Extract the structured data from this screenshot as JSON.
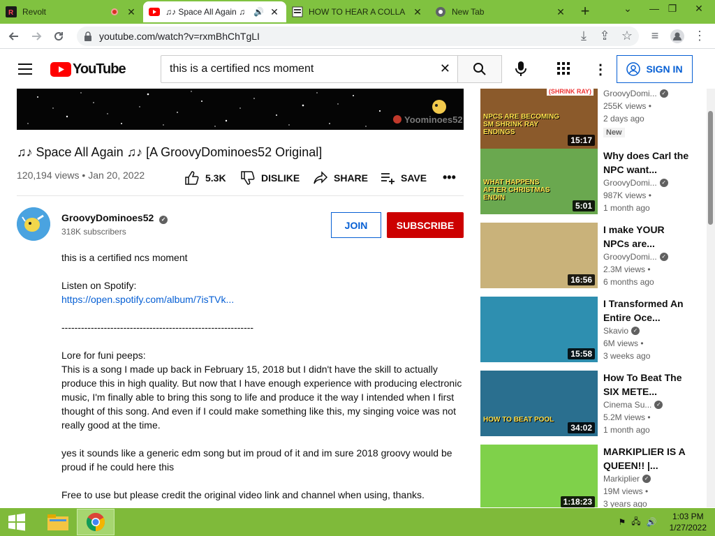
{
  "browser": {
    "tabs": [
      {
        "title": "Revolt",
        "icon": "revolt-icon",
        "recording": true
      },
      {
        "title": "♫♪ Space All Again ♫",
        "icon": "youtube-icon",
        "audio": true,
        "active": true
      },
      {
        "title": "HOW TO HEAR A COLLA",
        "icon": "page-icon"
      },
      {
        "title": "New Tab",
        "icon": "chrome-icon"
      }
    ],
    "url": "youtube.com/watch?v=rxmBhChTgLI"
  },
  "youtube": {
    "logo_text": "YouTube",
    "search_value": "this is a certified ncs moment",
    "signin_label": "SIGN IN"
  },
  "video": {
    "watermark": "Yoominoes52",
    "title": "♫♪ Space All Again ♫♪ [A GroovyDominoes52 Original]",
    "views": "120,194 views",
    "date": "Jan 20, 2022",
    "likes": "5.3K",
    "dislike_label": "DISLIKE",
    "share_label": "SHARE",
    "save_label": "SAVE"
  },
  "channel": {
    "name": "GroovyDominoes52",
    "subscribers": "318K subscribers",
    "join_label": "JOIN",
    "subscribe_label": "SUBSCRIBE"
  },
  "description": {
    "line1": "this is a certified ncs moment",
    "spotify_label": "Listen on Spotify:",
    "spotify_link": "https://open.spotify.com/album/7isTVk...",
    "separator": "-----------------------------------------------------------",
    "lore_title": "Lore for funi peeps:",
    "lore_body": "This is a song I made up back in February 15, 2018 but I didn't have the skill to actually produce this in high quality. But now that I have enough experience with producing electronic music, I'm finally able to bring this song to life and produce it the way I intended when I first thought of this song. And even if I could make something like this, my singing voice was not really good at the time.",
    "para2": "yes it sounds like a generic edm song but im proud of it and im sure 2018 groovy would be proud if he could here this",
    "para3": "Free to use but please credit the original video link and channel when using, thanks."
  },
  "recommendations": [
    {
      "title": "",
      "channel": "GroovyDomi...",
      "views": "255K views",
      "age": "2 days ago",
      "badge": "New",
      "duration": "15:17",
      "thumb_text": "NPCS ARE BECOMING SM SHRINK RAY ENDINGS",
      "thumb_tag": "(SHRINK RAY)",
      "thumb_color": "#8b5a2b"
    },
    {
      "title": "Why does Carl the NPC want...",
      "channel": "GroovyDomi...",
      "views": "987K views",
      "age": "1 month ago",
      "duration": "5:01",
      "thumb_text": "WHAT HAPPENS AFTER CHRISTMAS ENDIN",
      "thumb_color": "#6aa84f"
    },
    {
      "title": "I make YOUR NPCs are...",
      "channel": "GroovyDomi...",
      "views": "2.3M views",
      "age": "6 months ago",
      "duration": "16:56",
      "thumb_text": "",
      "thumb_color": "#c9b27a"
    },
    {
      "title": "I Transformed An Entire Oce...",
      "channel": "Skavio",
      "views": "6M views",
      "age": "3 weeks ago",
      "duration": "15:58",
      "thumb_text": "",
      "thumb_color": "#2e8fb0"
    },
    {
      "title": "How To Beat The SIX METE...",
      "channel": "Cinema Su...",
      "views": "5.2M views",
      "age": "1 month ago",
      "duration": "34:02",
      "thumb_text": "HOW TO BEAT POOL",
      "thumb_color": "#2a6f8f"
    },
    {
      "title": "MARKIPLIER IS A QUEEN!! |...",
      "channel": "Markiplier",
      "views": "19M views",
      "age": "3 years ago",
      "duration": "1:18:23",
      "thumb_text": "",
      "thumb_color": "#7fd14a"
    }
  ],
  "taskbar": {
    "time": "1:03 PM",
    "date": "1/27/2022"
  },
  "colors": {
    "accent": "#80c240",
    "youtube_red": "#ff0000",
    "subscribe": "#cc0000",
    "link": "#065fd4"
  }
}
